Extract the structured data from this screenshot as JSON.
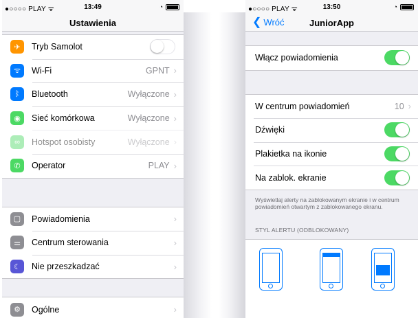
{
  "left": {
    "statusbar": {
      "carrier": "●○○○○ PLAY ᯤ",
      "time": "13:49"
    },
    "title": "Ustawienia",
    "group1": [
      {
        "label": "Tryb Samolot",
        "icon": "airplane-icon",
        "color": "#ff9500",
        "toggle": "off"
      },
      {
        "label": "Wi-Fi",
        "value": "GPNT",
        "icon": "wifi-icon",
        "color": "#007aff"
      },
      {
        "label": "Bluetooth",
        "value": "Wyłączone",
        "icon": "bluetooth-icon",
        "color": "#007aff"
      },
      {
        "label": "Sieć komórkowa",
        "value": "Wyłączone",
        "icon": "cellular-icon",
        "color": "#4cd964"
      },
      {
        "label": "Hotspot osobisty",
        "value": "Wyłączone",
        "icon": "hotspot-icon",
        "color": "#4cd964",
        "dim": true
      },
      {
        "label": "Operator",
        "value": "PLAY",
        "icon": "phone-icon",
        "color": "#4cd964"
      }
    ],
    "group2": [
      {
        "label": "Powiadomienia",
        "icon": "notifications-icon",
        "color": "#8e8e93"
      },
      {
        "label": "Centrum sterowania",
        "icon": "control-center-icon",
        "color": "#8e8e93"
      },
      {
        "label": "Nie przeszkadzać",
        "icon": "moon-icon",
        "color": "#5856d6"
      }
    ],
    "group3": [
      {
        "label": "Ogólne",
        "icon": "gear-icon",
        "color": "#8e8e93"
      }
    ]
  },
  "right": {
    "statusbar": {
      "carrier": "●○○○○ PLAY ᯤ",
      "time": "13:50"
    },
    "back_label": "Wróć",
    "title": "JuniorApp",
    "enable": {
      "label": "Włącz powiadomienia",
      "toggle": "on"
    },
    "rows": [
      {
        "label": "W centrum powiadomień",
        "value": "10"
      },
      {
        "label": "Dźwięki",
        "toggle": "on"
      },
      {
        "label": "Plakietka na ikonie",
        "toggle": "on"
      },
      {
        "label": "Na zablok. ekranie",
        "toggle": "on"
      }
    ],
    "note": "Wyświetlaj alerty na zablokowanym ekranie i w centrum powiadomień otwartym z zablokowanego ekranu.",
    "section_title": "STYL ALERTU (ODBLOKOWANY)",
    "alert_styles": [
      "none",
      "banner",
      "alert"
    ]
  },
  "colors": {
    "accent": "#007aff",
    "toggle_on": "#4cd964"
  }
}
